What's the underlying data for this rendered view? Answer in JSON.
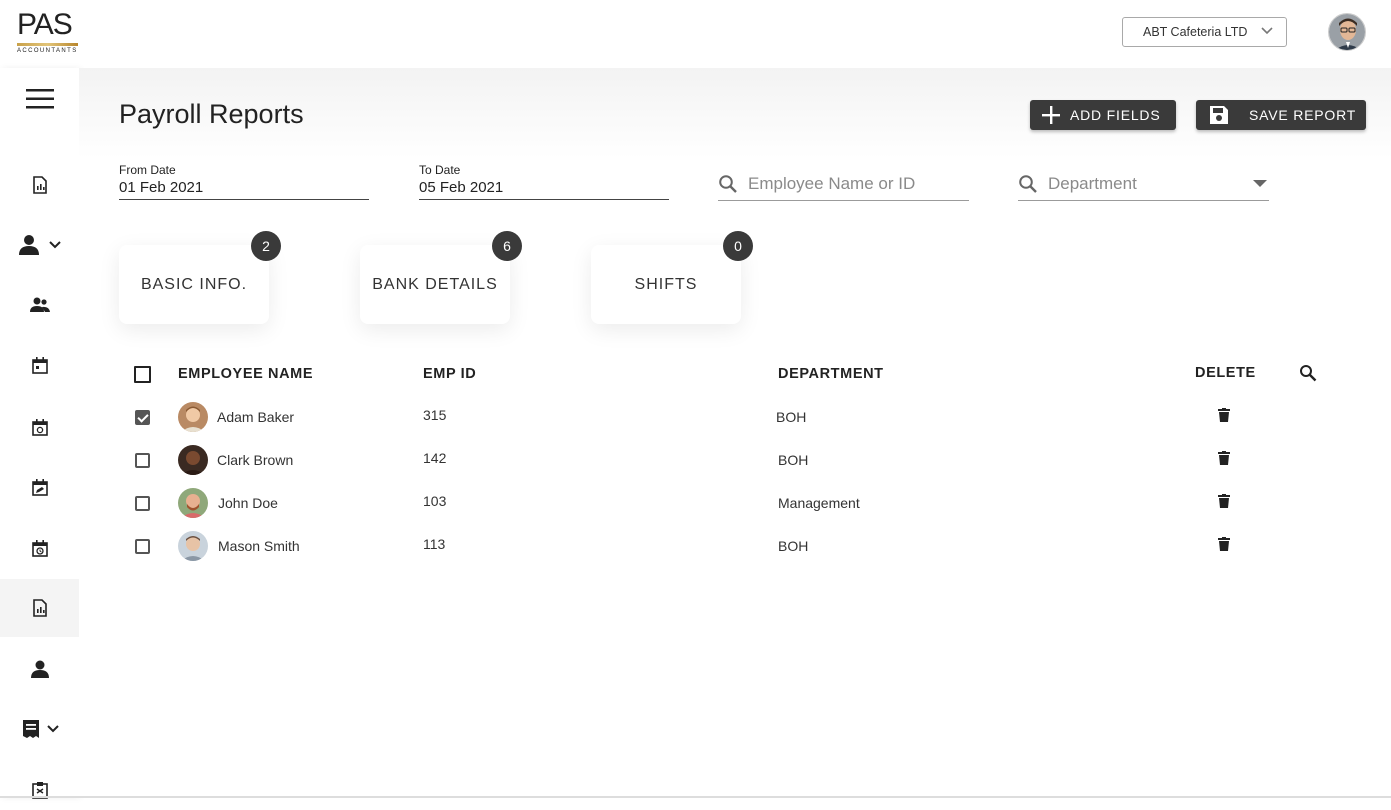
{
  "brand": {
    "logo_text": "PAS",
    "logo_sub": "ACCOUNTANTS",
    "accent_gold": "#c9a14a"
  },
  "header": {
    "company": "ABT Cafeteria LTD"
  },
  "page": {
    "title": "Payroll Reports"
  },
  "actions": {
    "add_fields": "ADD FIELDS",
    "save_report": "SAVE REPORT"
  },
  "filters": {
    "from_label": "From Date",
    "from_value": "01 Feb 2021",
    "to_label": "To Date",
    "to_value": "05 Feb 2021",
    "employee_placeholder": "Employee Name or ID",
    "department_placeholder": "Department"
  },
  "cards": [
    {
      "label": "BASIC INFO.",
      "count": "2"
    },
    {
      "label": "BANK DETAILS",
      "count": "6"
    },
    {
      "label": "SHIFTS",
      "count": "0"
    }
  ],
  "table": {
    "headers": {
      "name": "EMPLOYEE NAME",
      "id": "EMP ID",
      "department": "DEPARTMENT",
      "delete": "DELETE"
    },
    "rows": [
      {
        "name": "Adam Baker",
        "id": "315",
        "department": "BOH",
        "checked": true
      },
      {
        "name": "Clark Brown",
        "id": "142",
        "department": "BOH",
        "checked": false
      },
      {
        "name": "John Doe",
        "id": "103",
        "department": "Management",
        "checked": false
      },
      {
        "name": "Mason Smith",
        "id": "113",
        "department": "BOH",
        "checked": false
      }
    ]
  },
  "colors": {
    "button_bg": "#3a3a3a",
    "badge_bg": "#3a3a3a"
  }
}
